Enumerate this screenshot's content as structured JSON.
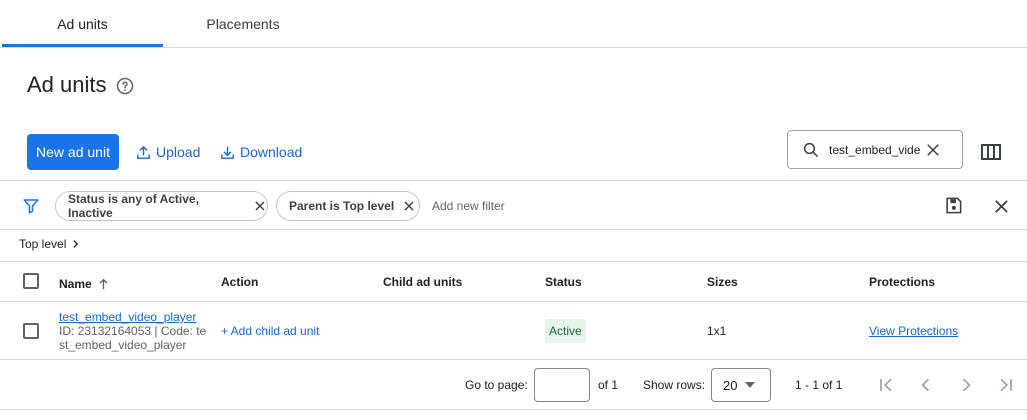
{
  "tabs": [
    {
      "label": "Ad units",
      "active": true
    },
    {
      "label": "Placements",
      "active": false
    }
  ],
  "page_title": "Ad units",
  "toolbar": {
    "new_label": "New ad unit",
    "upload_label": "Upload",
    "download_label": "Download"
  },
  "search": {
    "value": "test_embed_video_player"
  },
  "filters": [
    {
      "label": "Status is any of Active, Inactive"
    },
    {
      "label": "Parent is Top level"
    }
  ],
  "add_filter_label": "Add new filter",
  "breadcrumb": {
    "label": "Top level"
  },
  "table": {
    "headers": {
      "name": "Name",
      "action": "Action",
      "child": "Child ad units",
      "status": "Status",
      "sizes": "Sizes",
      "protections": "Protections"
    },
    "rows": [
      {
        "name": "test_embed_video_player",
        "meta": "ID: 23132164053 | Code: test_embed_video_player",
        "action": "+ Add child ad unit",
        "child": "",
        "status": "Active",
        "sizes": "1x1",
        "protections": "View Protections"
      }
    ]
  },
  "pagination": {
    "go_to_label": "Go to page:",
    "of_label": "of 1",
    "show_rows_label": "Show rows:",
    "rows_value": "20",
    "range_label": "1 - 1 of 1"
  },
  "colors": {
    "accent": "#1a73e8",
    "status_active_bg": "#e6f4ea",
    "status_active_text": "#137333"
  }
}
